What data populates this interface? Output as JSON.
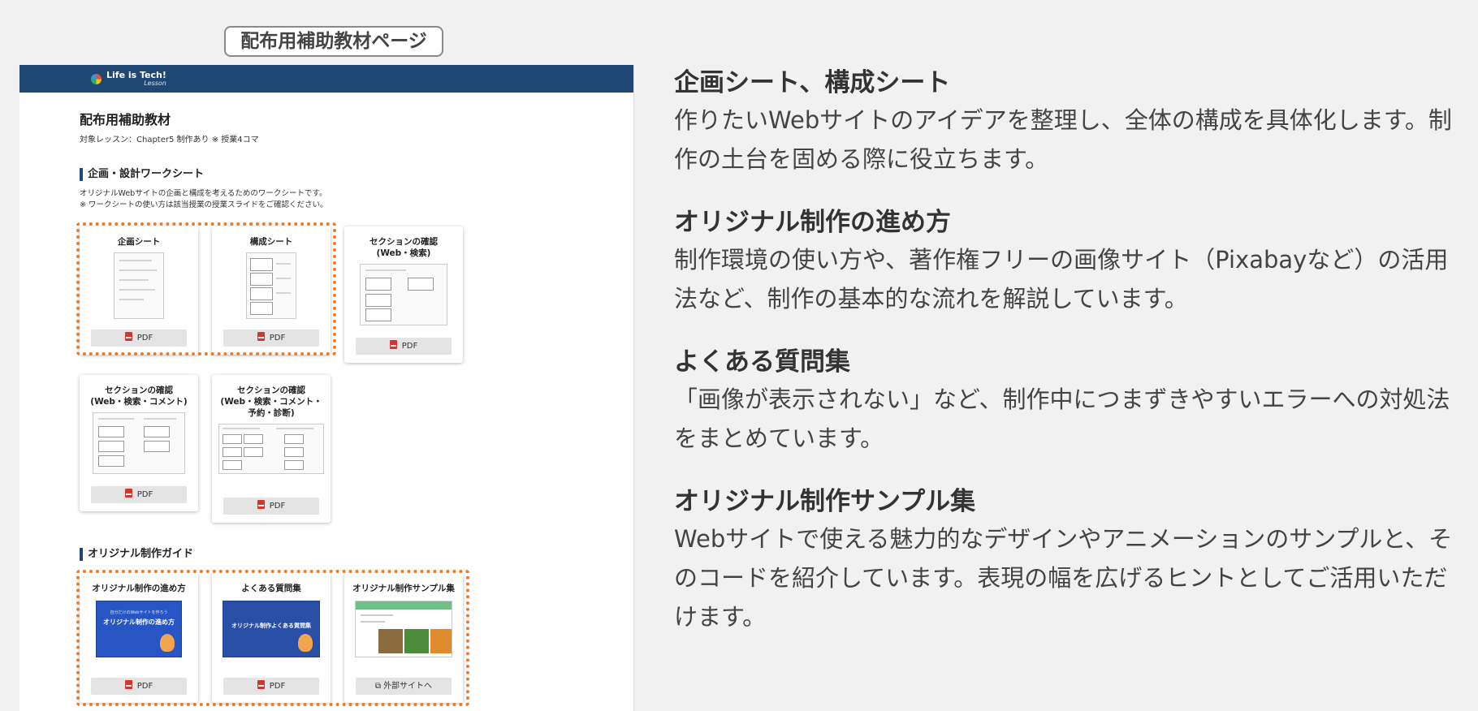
{
  "page_label": "配布用補助教材ページ",
  "screenshot": {
    "logo": {
      "text": "Life is Tech!",
      "sub": "Lesson"
    },
    "title": "配布用補助教材",
    "subtitle": "対象レッスン：Chapter5 制作あり ※ 授業4コマ",
    "section1": {
      "heading": "企画・設計ワークシート",
      "desc1": "オリジナルWebサイトの企画と構成を考えるためのワークシートです。",
      "desc2": "※ ワークシートの使い方は該当授業の授業スライドをご確認ください。",
      "cards": [
        {
          "title": "企画シート",
          "button": "PDF"
        },
        {
          "title": "構成シート",
          "button": "PDF"
        },
        {
          "title": "セクションの確認\n(Web・検索)",
          "button": "PDF"
        },
        {
          "title": "セクションの確認\n(Web・検索・コメント)",
          "button": "PDF"
        },
        {
          "title": "セクションの確認\n(Web・検索・コメント・\n予約・診断)",
          "button": "PDF"
        }
      ]
    },
    "section2": {
      "heading": "オリジナル制作ガイド",
      "cards": [
        {
          "title": "オリジナル制作の進め方",
          "cover_small": "自分だけのWebサイトを作ろう",
          "cover_big": "オリジナル制作の進め方",
          "button": "PDF"
        },
        {
          "title": "よくある質問集",
          "cover_big": "オリジナル制作よくある質問集",
          "button": "PDF"
        },
        {
          "title": "オリジナル制作サンプル集",
          "button": "外部サイトへ"
        }
      ]
    }
  },
  "items": [
    {
      "heading": "企画シート、構成シート",
      "body": "作りたいWebサイトのアイデアを整理し、全体の構成を具体化します。制作の土台を固める際に役立ちます。"
    },
    {
      "heading": "オリジナル制作の進め方",
      "body": "制作環境の使い方や、著作権フリーの画像サイト（Pixabayなど）の活用法など、制作の基本的な流れを解説しています。"
    },
    {
      "heading": "よくある質問集",
      "body": "「画像が表示されない」など、制作中につまずきやすいエラーへの対処法をまとめています。"
    },
    {
      "heading": "オリジナル制作サンプル集",
      "body": "Webサイトで使える魅力的なデザインやアニメーションのサンプルと、そのコードを紹介しています。表現の幅を広げるヒントとしてご活用いただけます。"
    }
  ],
  "colors": {
    "header": "#1f4775",
    "highlight": "#ee7a26",
    "pdf": "#d9322f"
  }
}
